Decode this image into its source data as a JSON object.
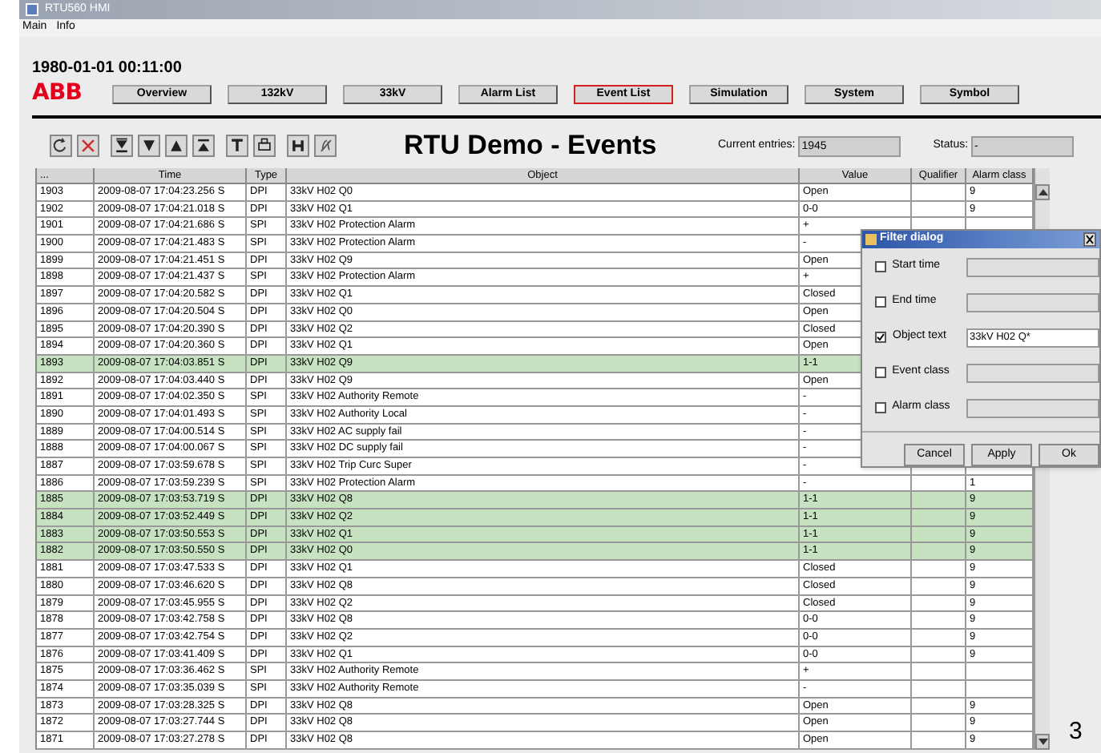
{
  "window": {
    "title": "RTU560 HMI"
  },
  "menu": [
    "Main",
    "Info"
  ],
  "header": {
    "datetime": "1980-01-01 00:11:00",
    "logo": "ABB"
  },
  "nav": [
    {
      "label": "Overview",
      "selected": false
    },
    {
      "label": "132kV",
      "selected": false
    },
    {
      "label": "33kV",
      "selected": false
    },
    {
      "label": "Alarm List",
      "selected": false
    },
    {
      "label": "Event List",
      "selected": true
    },
    {
      "label": "Simulation",
      "selected": false
    },
    {
      "label": "System",
      "selected": false
    },
    {
      "label": "Symbol",
      "selected": false
    }
  ],
  "page_title": "RTU Demo - Events",
  "current_entries": {
    "label": "Current entries:",
    "value": "1945"
  },
  "status": {
    "label": "Status:",
    "value": "-"
  },
  "table": {
    "columns": [
      "...",
      "Time",
      "Type",
      "Object",
      "Value",
      "Qualifier",
      "Alarm class"
    ],
    "rows": [
      {
        "no": "1903",
        "time": "2009-08-07 17:04:23.256 S",
        "type": "DPI",
        "object": "33kV H02 Q0",
        "value": "Open",
        "alarm_class": "9",
        "highlighted": false
      },
      {
        "no": "1902",
        "time": "2009-08-07 17:04:21.018 S",
        "type": "DPI",
        "object": "33kV H02 Q1",
        "value": "0-0",
        "alarm_class": "9",
        "highlighted": false
      },
      {
        "no": "1901",
        "time": "2009-08-07 17:04:21.686 S",
        "type": "SPI",
        "object": "33kV H02 Protection Alarm",
        "value": "+",
        "highlighted": false
      },
      {
        "no": "1900",
        "time": "2009-08-07 17:04:21.483 S",
        "type": "SPI",
        "object": "33kV H02 Protection Alarm",
        "value": "-",
        "highlighted": false
      },
      {
        "no": "1899",
        "time": "2009-08-07 17:04:21.451 S",
        "type": "DPI",
        "object": "33kV H02 Q9",
        "value": "Open",
        "highlighted": false
      },
      {
        "no": "1898",
        "time": "2009-08-07 17:04:21.437 S",
        "type": "SPI",
        "object": "33kV H02 Protection Alarm",
        "value": "+",
        "highlighted": false
      },
      {
        "no": "1897",
        "time": "2009-08-07 17:04:20.582 S",
        "type": "DPI",
        "object": "33kV H02 Q1",
        "value": "Closed",
        "highlighted": false
      },
      {
        "no": "1896",
        "time": "2009-08-07 17:04:20.504 S",
        "type": "DPI",
        "object": "33kV H02 Q0",
        "value": "Open",
        "highlighted": false
      },
      {
        "no": "1895",
        "time": "2009-08-07 17:04:20.390 S",
        "type": "DPI",
        "object": "33kV H02 Q2",
        "value": "Closed",
        "highlighted": false
      },
      {
        "no": "1894",
        "time": "2009-08-07 17:04:20.360 S",
        "type": "DPI",
        "object": "33kV H02 Q1",
        "value": "Open",
        "highlighted": false
      },
      {
        "no": "1893",
        "time": "2009-08-07 17:04:03.851 S",
        "type": "DPI",
        "object": "33kV H02 Q9",
        "value": "1-1",
        "highlighted": true
      },
      {
        "no": "1892",
        "time": "2009-08-07 17:04:03.440 S",
        "type": "DPI",
        "object": "33kV H02 Q9",
        "value": "Open",
        "highlighted": false
      },
      {
        "no": "1891",
        "time": "2009-08-07 17:04:02.350 S",
        "type": "SPI",
        "object": "33kV H02 Authority Remote",
        "value": "-",
        "highlighted": false
      },
      {
        "no": "1890",
        "time": "2009-08-07 17:04:01.493 S",
        "type": "SPI",
        "object": "33kV H02 Authority Local",
        "value": "-",
        "highlighted": false
      },
      {
        "no": "1889",
        "time": "2009-08-07 17:04:00.514 S",
        "type": "SPI",
        "object": "33kV H02 AC supply fail",
        "value": "-",
        "highlighted": false
      },
      {
        "no": "1888",
        "time": "2009-08-07 17:04:00.067 S",
        "type": "SPI",
        "object": "33kV H02 DC supply fail",
        "value": "-",
        "highlighted": false
      },
      {
        "no": "1887",
        "time": "2009-08-07 17:03:59.678 S",
        "type": "SPI",
        "object": "33kV H02 Trip Curc Super",
        "value": "-",
        "highlighted": false
      },
      {
        "no": "1886",
        "time": "2009-08-07 17:03:59.239 S",
        "type": "SPI",
        "object": "33kV H02 Protection Alarm",
        "value": "-",
        "alarm_class": "1",
        "highlighted": false
      },
      {
        "no": "1885",
        "time": "2009-08-07 17:03:53.719 S",
        "type": "DPI",
        "object": "33kV H02 Q8",
        "value": "1-1",
        "alarm_class": "9",
        "highlighted": true
      },
      {
        "no": "1884",
        "time": "2009-08-07 17:03:52.449 S",
        "type": "DPI",
        "object": "33kV H02 Q2",
        "value": "1-1",
        "alarm_class": "9",
        "highlighted": true
      },
      {
        "no": "1883",
        "time": "2009-08-07 17:03:50.553 S",
        "type": "DPI",
        "object": "33kV H02 Q1",
        "value": "1-1",
        "alarm_class": "9",
        "highlighted": true
      },
      {
        "no": "1882",
        "time": "2009-08-07 17:03:50.550 S",
        "type": "DPI",
        "object": "33kV H02 Q0",
        "value": "1-1",
        "alarm_class": "9",
        "highlighted": true
      },
      {
        "no": "1881",
        "time": "2009-08-07 17:03:47.533 S",
        "type": "DPI",
        "object": "33kV H02 Q1",
        "value": "Closed",
        "alarm_class": "9",
        "highlighted": false
      },
      {
        "no": "1880",
        "time": "2009-08-07 17:03:46.620 S",
        "type": "DPI",
        "object": "33kV H02 Q8",
        "value": "Closed",
        "alarm_class": "9",
        "highlighted": false
      },
      {
        "no": "1879",
        "time": "2009-08-07 17:03:45.955 S",
        "type": "DPI",
        "object": "33kV H02 Q2",
        "value": "Closed",
        "alarm_class": "9",
        "highlighted": false
      },
      {
        "no": "1878",
        "time": "2009-08-07 17:03:42.758 S",
        "type": "DPI",
        "object": "33kV H02 Q8",
        "value": "0-0",
        "alarm_class": "9",
        "highlighted": false
      },
      {
        "no": "1877",
        "time": "2009-08-07 17:03:42.754 S",
        "type": "DPI",
        "object": "33kV H02 Q2",
        "value": "0-0",
        "alarm_class": "9",
        "highlighted": false
      },
      {
        "no": "1876",
        "time": "2009-08-07 17:03:41.409 S",
        "type": "DPI",
        "object": "33kV H02 Q1",
        "value": "0-0",
        "alarm_class": "9",
        "highlighted": false
      },
      {
        "no": "1875",
        "time": "2009-08-07 17:03:36.462 S",
        "type": "SPI",
        "object": "33kV H02 Authority Remote",
        "value": "+",
        "highlighted": false
      },
      {
        "no": "1874",
        "time": "2009-08-07 17:03:35.039 S",
        "type": "SPI",
        "object": "33kV H02 Authority Remote",
        "value": "-",
        "highlighted": false
      },
      {
        "no": "1873",
        "time": "2009-08-07 17:03:28.325 S",
        "type": "DPI",
        "object": "33kV H02 Q8",
        "value": "Open",
        "alarm_class": "9",
        "highlighted": false
      },
      {
        "no": "1872",
        "time": "2009-08-07 17:03:27.744 S",
        "type": "DPI",
        "object": "33kV H02 Q8",
        "value": "Open",
        "alarm_class": "9",
        "highlighted": false
      },
      {
        "no": "1871",
        "time": "2009-08-07 17:03:27.278 S",
        "type": "DPI",
        "object": "33kV H02 Q8",
        "value": "Open",
        "alarm_class": "9",
        "highlighted": false
      }
    ]
  },
  "filter_dialog": {
    "title": "Filter dialog",
    "filters": [
      {
        "label": "Start time",
        "checked": false
      },
      {
        "label": "End time",
        "checked": false
      },
      {
        "label": "Object text",
        "checked": true,
        "value": "33kV H02 Q*"
      },
      {
        "label": "Event class",
        "checked": false
      },
      {
        "label": "Alarm class",
        "checked": false
      }
    ],
    "buttons": [
      "Cancel",
      "Apply",
      "Ok"
    ]
  },
  "figure_number": "3"
}
